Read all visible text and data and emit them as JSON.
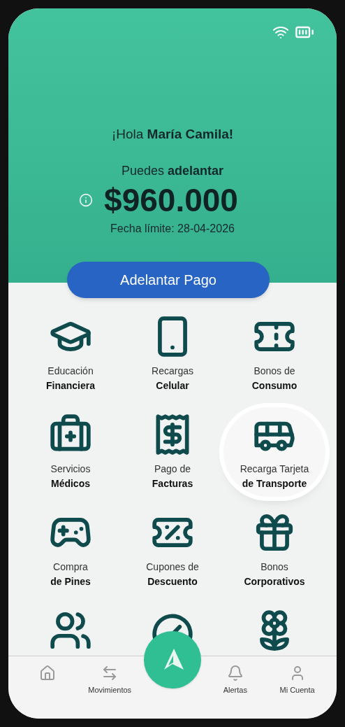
{
  "header": {
    "greeting": "¡Hola **María Camila!**",
    "subtitle": "Puedes **adelantar**",
    "amount": "$960.000",
    "deadline": "Fecha límite: 28-04-2026"
  },
  "primary_button": "Adelantar Pago",
  "services": [
    {
      "line1": "Educación",
      "line2": "Financiera",
      "highlighted": false
    },
    {
      "line1": "Recargas",
      "line2": "Celular",
      "highlighted": false
    },
    {
      "line1": "Bonos de",
      "line2": "Consumo",
      "highlighted": false
    },
    {
      "line1": "Servicios",
      "line2": "Médicos",
      "highlighted": false
    },
    {
      "line1": "Pago de",
      "line2": "Facturas",
      "highlighted": false
    },
    {
      "line1": "Recarga Tarjeta",
      "line2": "de Transporte",
      "highlighted": true
    },
    {
      "line1": "Compra",
      "line2": "de Pines",
      "highlighted": false
    },
    {
      "line1": "Cupones de",
      "line2": "Descuento",
      "highlighted": false
    },
    {
      "line1": "Bonos",
      "line2": "Corporativos",
      "highlighted": false
    },
    {
      "highlighted": false
    },
    {
      "highlighted": false
    },
    {
      "highlighted": false
    }
  ],
  "bottom_nav": [
    {
      "kind": "tab"
    },
    {
      "kind": "tab",
      "label": "Movimientos"
    },
    {
      "kind": "logo"
    },
    {
      "kind": "tab",
      "label": "Alertas"
    },
    {
      "kind": "tab",
      "label": "Mi Cuenta"
    }
  ]
}
